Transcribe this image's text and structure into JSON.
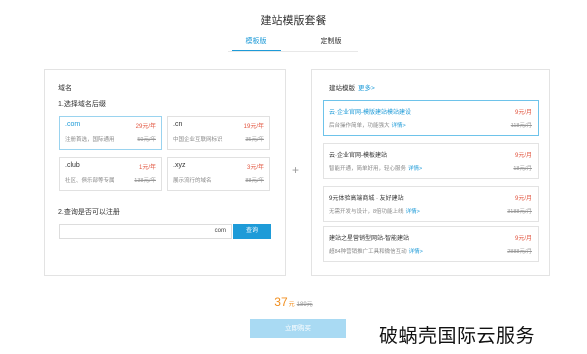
{
  "header": {
    "title": "建站模版套餐"
  },
  "tabs": [
    {
      "label": "模板版",
      "active": true
    },
    {
      "label": "定制版",
      "active": false
    }
  ],
  "domain_section": {
    "title": "域名",
    "step1_label": "1.选择域名后缀",
    "options": [
      {
        "suffix": ".com",
        "price": "29元/年",
        "desc": "注册首选，国际通用",
        "old_price": "59元/年",
        "selected": true
      },
      {
        "suffix": ".cn",
        "price": "19元/年",
        "desc": "中国企业互联网标识",
        "old_price": "35元/年",
        "selected": false
      },
      {
        "suffix": ".club",
        "price": "1元/年",
        "desc": "社区、俱乐部等专属",
        "old_price": "138元/年",
        "selected": false
      },
      {
        "suffix": ".xyz",
        "price": "3元/年",
        "desc": "展示流行的域名",
        "old_price": "88元/年",
        "selected": false
      }
    ],
    "step2_label": "2.查询是否可以注册",
    "input_value": "",
    "input_suffix": "com",
    "query_button": "查询"
  },
  "plus_symbol": "+",
  "template_section": {
    "title": "建站模版",
    "more_link": "更多>",
    "detail_link": "详情>",
    "templates": [
      {
        "name": "云·企业官网-模版建站模站建设",
        "sub": "后台操作简单，功能强大",
        "price": "9元/月",
        "old_price": "118元/月",
        "selected": true
      },
      {
        "name": "云·企业官网-模板建站",
        "sub": "智能开通，简单好用，轻心服务",
        "price": "9元/月",
        "old_price": "18元/月",
        "selected": false
      },
      {
        "name": "9元体验高端商城 · 友好建站",
        "sub": "无需开发与设计，8倍功能上线",
        "price": "9元/月",
        "old_price": "3188元/月",
        "selected": false
      },
      {
        "name": "建站之星营销型网站-智能建站",
        "sub": "超84种营销推广工具和微信互动",
        "price": "9元/月",
        "old_price": "2888元/月",
        "selected": false
      }
    ]
  },
  "summary": {
    "amount": "37",
    "unit": "元",
    "original": "189元"
  },
  "buy_button": "立即购买",
  "watermark": "破蜗壳国际云服务",
  "colors": {
    "accent": "#1e9bd8",
    "price_red": "#e2553f",
    "total_orange": "#f18e1d",
    "buy_button": "#a9daf3"
  }
}
